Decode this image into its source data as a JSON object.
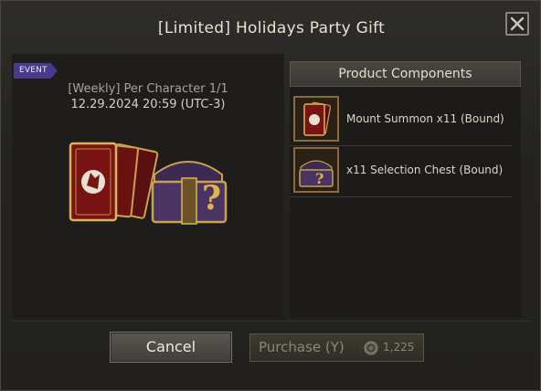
{
  "dialog": {
    "title": "[Limited] Holidays Party Gift",
    "close_icon": "close-icon"
  },
  "product": {
    "badge": "EVENT",
    "limit": "[Weekly] Per Character 1/1",
    "expiry": "12.29.2024 20:59 (UTC-3)"
  },
  "components": {
    "header": "Product Components",
    "items": [
      {
        "label": "Mount Summon x11 (Bound)",
        "icon": "card-pack-icon"
      },
      {
        "label": "x11 Selection Chest (Bound)",
        "icon": "chest-icon"
      }
    ]
  },
  "actions": {
    "cancel_label": "Cancel",
    "purchase_label": "Purchase (Y)",
    "price": "1,225",
    "currency_icon": "coin-icon"
  },
  "colors": {
    "event_badge": "#4a3a8c",
    "frame_gold": "#8a6a3a"
  }
}
